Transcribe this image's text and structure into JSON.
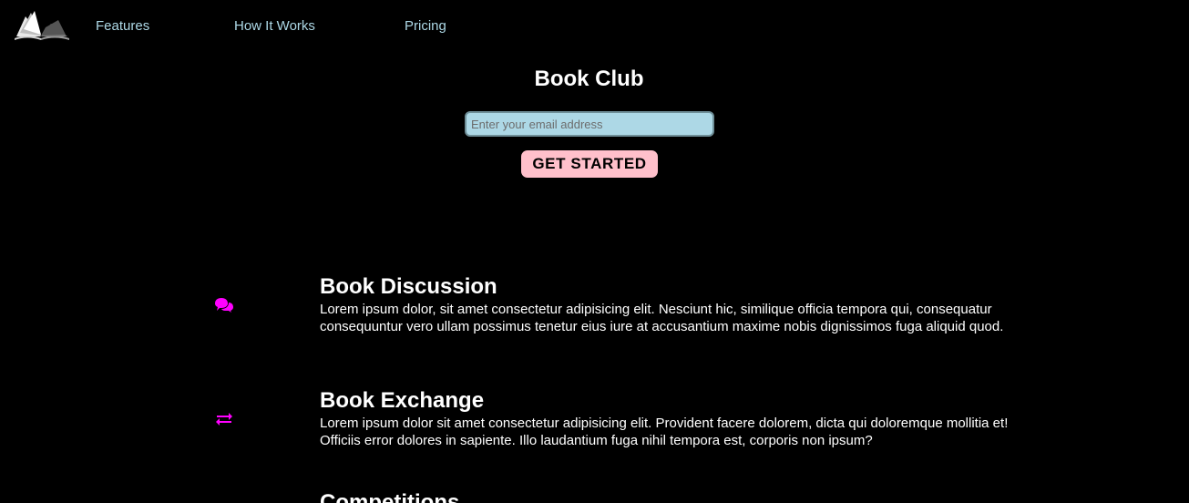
{
  "nav": {
    "links": [
      {
        "label": "Features"
      },
      {
        "label": "How It Works"
      },
      {
        "label": "Pricing"
      }
    ]
  },
  "hero": {
    "title": "Book Club",
    "email_placeholder": "Enter your email address",
    "cta_label": "GET STARTED"
  },
  "features": [
    {
      "icon": "comments-icon",
      "title": "Book Discussion",
      "text": "Lorem ipsum dolor, sit amet consectetur adipisicing elit. Nesciunt hic, similique officia tempora qui, consequatur consequuntur vero ullam possimus tenetur eius iure at accusantium maxime nobis dignissimos fuga aliquid quod."
    },
    {
      "icon": "exchange-icon",
      "title": "Book Exchange",
      "text": "Lorem ipsum dolor sit amet consectetur adipisicing elit. Provident facere dolorem, dicta qui doloremque mollitia et! Officiis error dolores in sapiente. Illo laudantium fuga nihil tempora est, corporis non ipsum?"
    },
    {
      "title": "Competitions"
    }
  ],
  "colors": {
    "background": "#000000",
    "nav_link": "#add8e6",
    "input_bg": "#add8e6",
    "cta_bg": "#ffc0cb",
    "icon": "#ff00ff",
    "text": "#ffffff"
  }
}
